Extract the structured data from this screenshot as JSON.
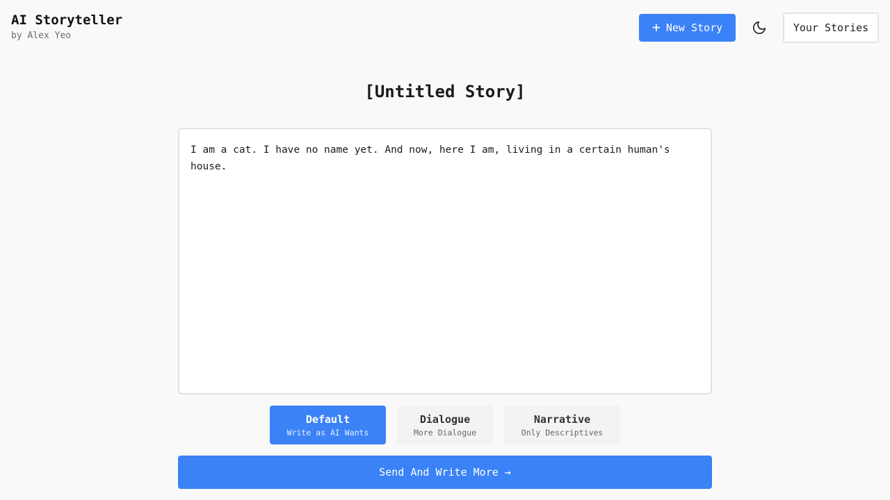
{
  "header": {
    "app_title": "AI Storyteller",
    "byline": "by Alex Yeo",
    "new_story_label": "New Story",
    "plus_icon": "+",
    "theme_toggle_icon": "moon-icon",
    "your_stories_label": "Your Stories"
  },
  "story": {
    "title": "[Untitled Story]",
    "text": "I am a cat. I have no name yet. And now, here I am, living in a certain human's house."
  },
  "modes": [
    {
      "label": "Default",
      "description": "Write as AI Wants",
      "active": true
    },
    {
      "label": "Dialogue",
      "description": "More Dialogue",
      "active": false
    },
    {
      "label": "Narrative",
      "description": "Only Descriptives",
      "active": false
    }
  ],
  "send_label": "Send And Write More →",
  "colors": {
    "accent": "#3b82f6",
    "background": "#f9f9f9"
  }
}
